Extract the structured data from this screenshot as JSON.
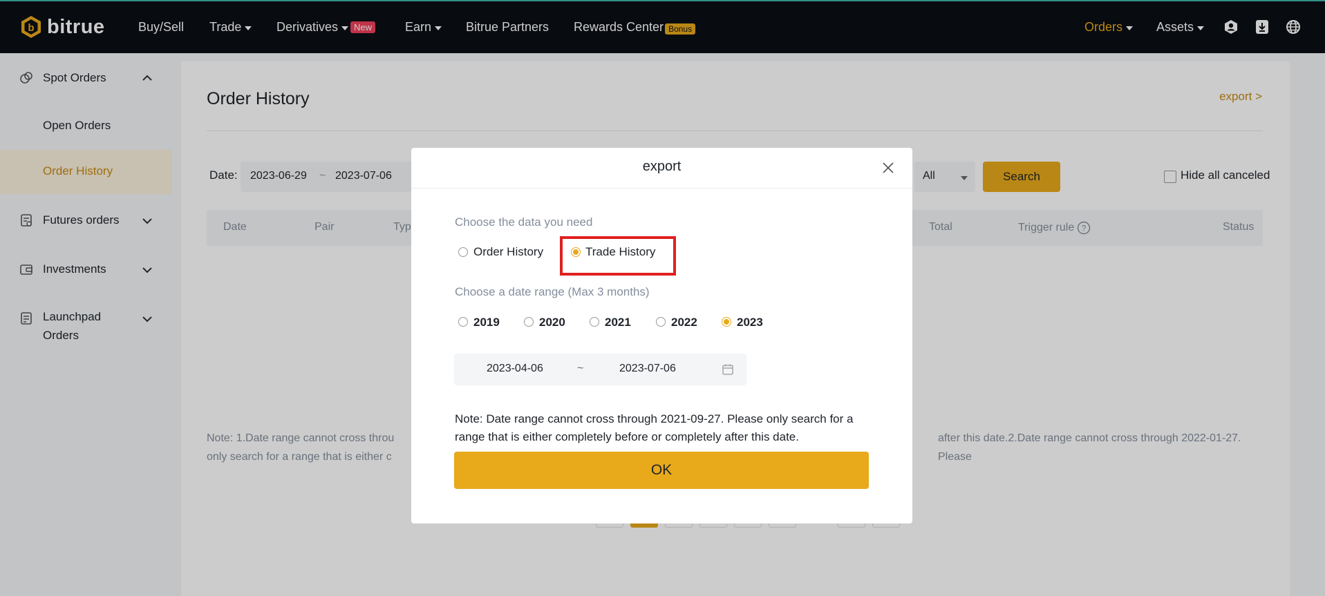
{
  "brand": {
    "name": "bitrue",
    "accent": "#e8a91b"
  },
  "nav": {
    "buy_sell": "Buy/Sell",
    "trade": "Trade",
    "derivatives": "Derivatives",
    "derivatives_badge": "New",
    "earn": "Earn",
    "partners": "Bitrue Partners",
    "rewards": "Rewards Center",
    "rewards_badge": "Bonus",
    "orders": "Orders",
    "assets": "Assets",
    "icons": [
      "user-icon",
      "download-icon",
      "globe-icon"
    ]
  },
  "sidebar": {
    "spot_orders": "Spot Orders",
    "open_orders": "Open Orders",
    "order_history": "Order History",
    "futures_orders": "Futures orders",
    "investments": "Investments",
    "launchpad_line1": "Launchpad",
    "launchpad_line2": "Orders"
  },
  "main": {
    "title": "Order History",
    "export_link": "export >",
    "date_label": "Date:",
    "date_from": "2023-06-29",
    "date_sep": "~",
    "date_to": "2023-07-06",
    "select_value": "All",
    "search_button": "Search",
    "hide_canceled": "Hide all canceled",
    "columns": [
      "Date",
      "Pair",
      "Typ",
      "Total",
      "Trigger rule",
      "Status"
    ],
    "note_line1_left": "Note: 1.Date range cannot cross throu",
    "note_line1_right": "after this date.2.Date range cannot cross through 2022-01-27. Please",
    "note_line2_left": "only search for a range that is either c"
  },
  "modal": {
    "title": "export",
    "choose_data_label": "Choose the data you need",
    "option_order_history": "Order History",
    "option_trade_history": "Trade History",
    "selected_data": "Trade History",
    "choose_range_label": "Choose a date range (Max 3 months)",
    "years": [
      "2019",
      "2020",
      "2021",
      "2022",
      "2023"
    ],
    "selected_year": "2023",
    "range_from": "2023-04-06",
    "range_sep": "~",
    "range_to": "2023-07-06",
    "note": "Note: Date range cannot cross through 2021-09-27. Please only search for a range that is either completely before or completely after this date.",
    "ok_button": "OK"
  }
}
